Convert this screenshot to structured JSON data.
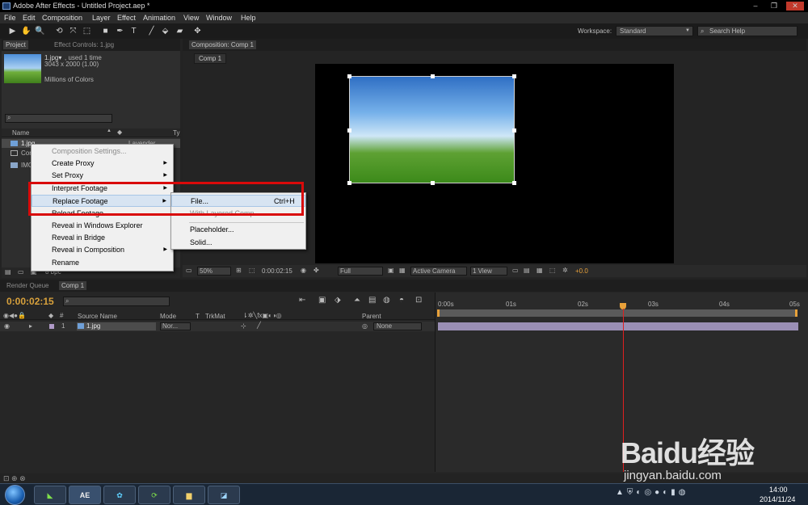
{
  "window": {
    "title": "Adobe After Effects - Untitled Project.aep *",
    "minimize_glyph": "–",
    "restore_glyph": "❐",
    "close_glyph": "✕"
  },
  "menubar": [
    "File",
    "Edit",
    "Composition",
    "Layer",
    "Effect",
    "Animation",
    "View",
    "Window",
    "Help"
  ],
  "toolbar": {
    "tools": [
      "▶",
      "✋",
      "🔍",
      "⟲",
      "⤧",
      "⬚",
      "■",
      "✒",
      "T",
      "╱",
      "⬙",
      "▰",
      "✥"
    ],
    "workspace_label": "Workspace:",
    "workspace_value": "Standard",
    "search_placeholder": "Search Help"
  },
  "project_panel": {
    "tab_project": "Project",
    "tab_effect_controls": "Effect Controls: 1.jpg",
    "footage_name": "1.jpg▾",
    "footage_used": ", used 1 time",
    "footage_dims": "3043 x 2000 (1.00)",
    "footage_colors": "Millions of Colors",
    "col_name": "Name",
    "col_type": "Ty",
    "items": [
      {
        "name": "1.jpg",
        "label": "Lavender"
      },
      {
        "name": "Com"
      },
      {
        "name": "IMG"
      }
    ],
    "bpc": "8 bpc"
  },
  "context_menu": {
    "items": [
      {
        "label": "Composition Settings...",
        "disabled": true
      },
      {
        "label": "Create Proxy",
        "submenu": true
      },
      {
        "label": "Set Proxy",
        "submenu": true
      },
      {
        "label": "Interpret Footage",
        "submenu": true
      },
      {
        "label": "Replace Footage",
        "submenu": true,
        "highlighted": true
      },
      {
        "label": "Reload Footage"
      },
      {
        "label": "Reveal in Windows Explorer"
      },
      {
        "label": "Reveal in Bridge"
      },
      {
        "label": "Reveal in Composition",
        "submenu": true
      },
      {
        "label": "Rename"
      }
    ]
  },
  "submenu": {
    "items": [
      {
        "label": "File...",
        "shortcut": "Ctrl+H",
        "highlighted": true
      },
      {
        "label": "With Layered Comp",
        "disabled": true
      },
      {
        "label": "Placeholder..."
      },
      {
        "label": "Solid..."
      }
    ]
  },
  "composition": {
    "tab": "Composition: Comp 1",
    "subtab": "Comp 1",
    "zoom": "50%",
    "timecode": "0:00:02:15",
    "resolution": "Full",
    "camera": "Active Camera",
    "views": "1 View",
    "exposure": "+0.0"
  },
  "timeline": {
    "tab_render": "Render Queue",
    "tab_comp": "Comp 1",
    "timecode": "0:00:02:15",
    "headers": {
      "source": "Source Name",
      "mode": "Mode",
      "t": "T",
      "trkmat": "TrkMat",
      "parent": "Parent"
    },
    "layer": {
      "index": "1",
      "name": "1.jpg",
      "mode": "Nor...",
      "parent": "None"
    },
    "ruler": [
      "0:00s",
      "01s",
      "02s",
      "03s",
      "04s",
      "05s"
    ]
  },
  "taskbar": {
    "time": "14:00",
    "date": "2014/11/24",
    "app_label": "AE"
  },
  "watermark": {
    "brand": "Baidu经验",
    "url": "jingyan.baidu.com"
  },
  "colors": {
    "accent_orange": "#e8a13a",
    "timecode": "#d8a13c",
    "highlight_box": "#d90a0a",
    "layer_bar": "#9a8fb5",
    "playhead": "#e02020"
  }
}
